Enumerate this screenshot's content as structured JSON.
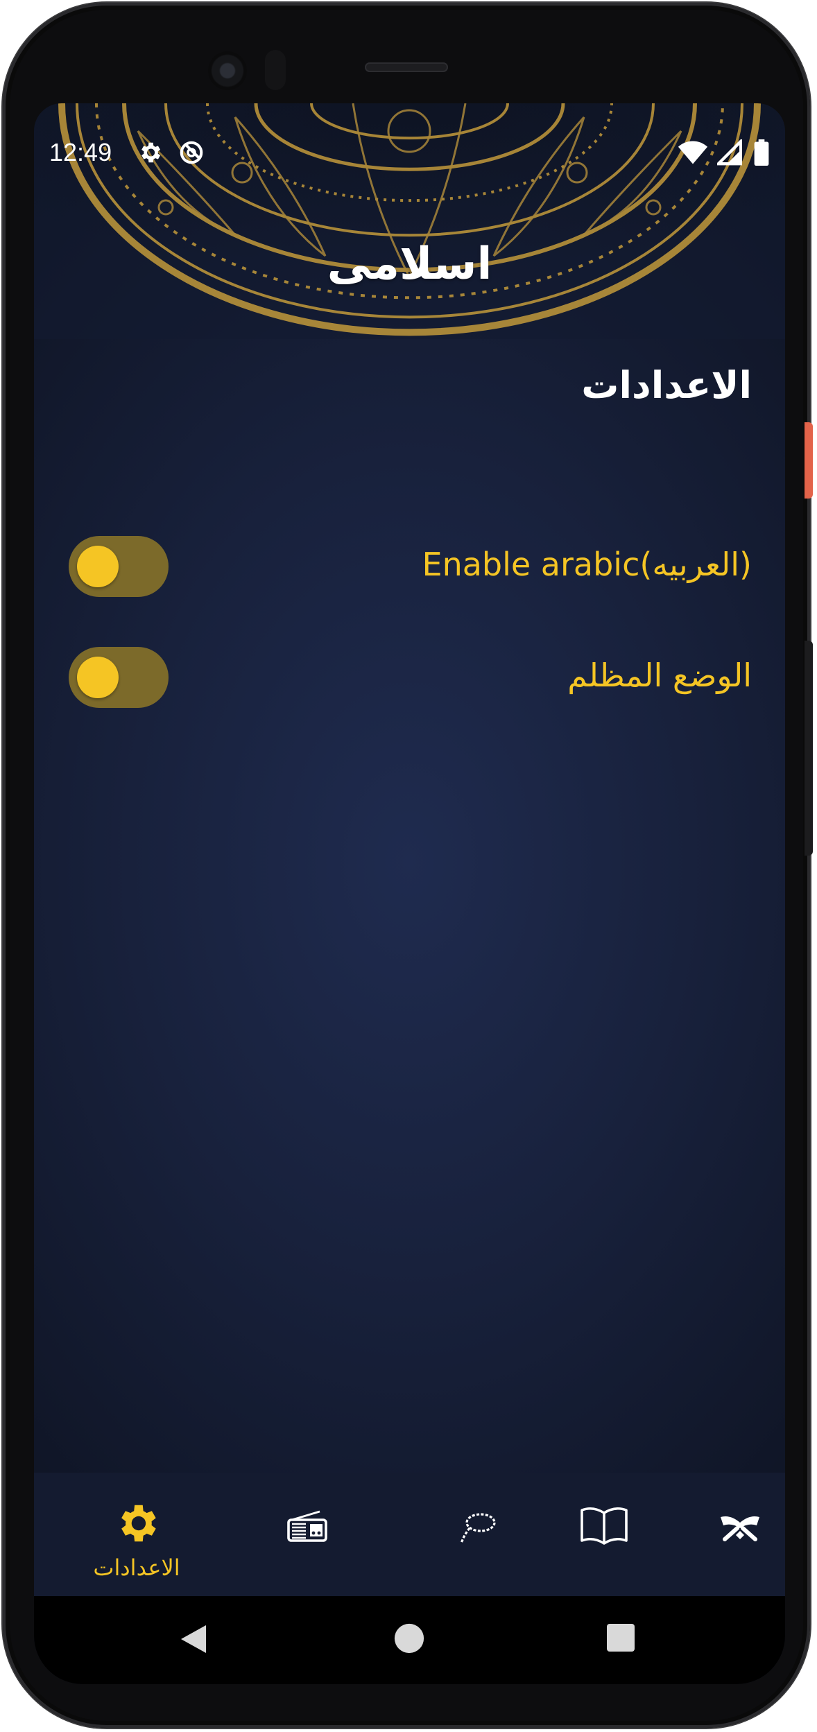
{
  "colors": {
    "accent": "#f5c524",
    "background": "#18213c",
    "nav_background": "#141b30",
    "toggle_track": "#7c6a2a",
    "text_primary": "#ffffff"
  },
  "status_bar": {
    "time": "12:49",
    "icons": [
      "gear-icon",
      "do-not-disturb-icon",
      "wifi-icon",
      "signal-icon",
      "battery-icon"
    ]
  },
  "app": {
    "title": "اسلامى"
  },
  "settings": {
    "title": "الاعدادات",
    "items": [
      {
        "label": "Enable arabic(العربيه)",
        "enabled": false
      },
      {
        "label": "الوضع المظلم",
        "enabled": false
      }
    ]
  },
  "bottom_nav": {
    "selected": 0,
    "items": [
      {
        "icon": "gear-icon",
        "label": "الاعدادات"
      },
      {
        "icon": "radio-icon",
        "label": ""
      },
      {
        "icon": "tasbeeh-icon",
        "label": ""
      },
      {
        "icon": "book-icon",
        "label": ""
      },
      {
        "icon": "quran-icon",
        "label": ""
      }
    ]
  },
  "system_nav": [
    "back-icon",
    "home-icon",
    "recents-icon"
  ]
}
